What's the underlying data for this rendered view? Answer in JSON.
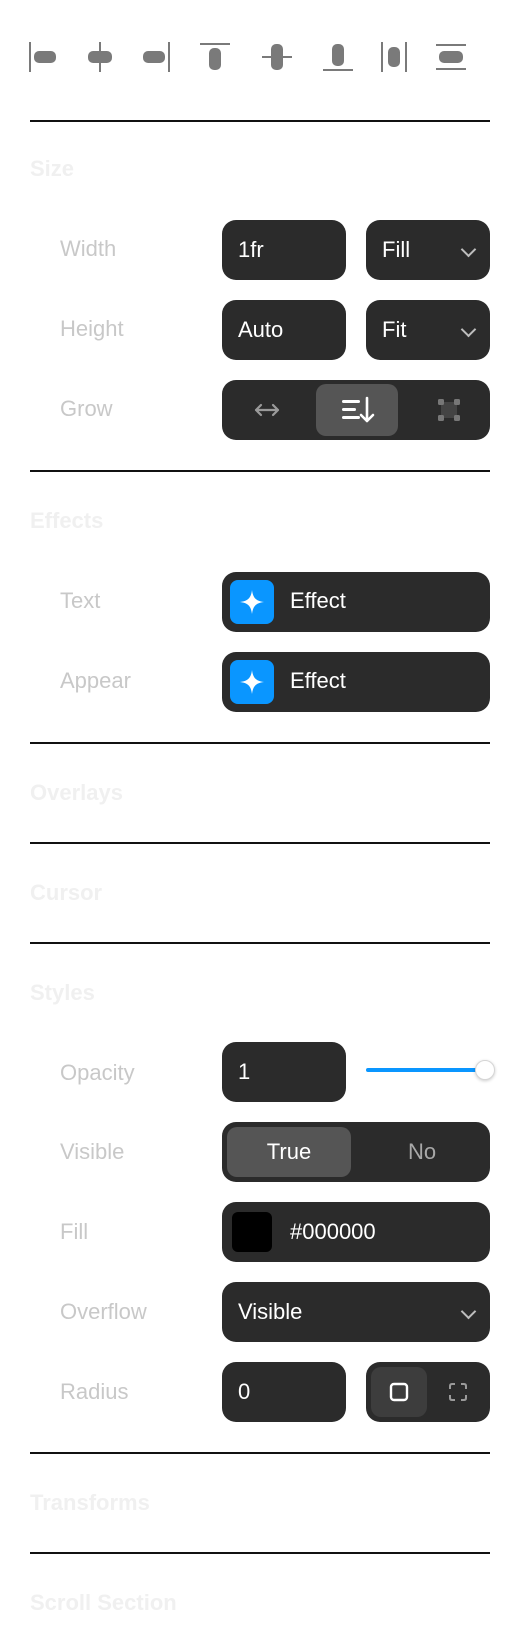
{
  "alignment": {
    "icons": [
      "align-left-icon",
      "align-center-horizontal-icon",
      "align-right-icon",
      "align-top-icon",
      "align-center-vertical-icon",
      "align-bottom-icon",
      "distribute-horizontal-icon",
      "distribute-vertical-icon"
    ]
  },
  "size": {
    "title": "Size",
    "width_label": "Width",
    "width_value": "1fr",
    "width_mode": "Fill",
    "height_label": "Height",
    "height_value": "Auto",
    "height_mode": "Fit",
    "grow_label": "Grow",
    "grow_icons": [
      "horizontal-arrows-icon",
      "text-sort-down-icon",
      "resize-corners-icon"
    ],
    "grow_selected_index": 1
  },
  "effects": {
    "title": "Effects",
    "text_label": "Text",
    "text_effect": "Effect",
    "appear_label": "Appear",
    "appear_effect": "Effect",
    "accent": "#0a96ff"
  },
  "overlays": {
    "title": "Overlays"
  },
  "cursor": {
    "title": "Cursor"
  },
  "styles": {
    "title": "Styles",
    "opacity_label": "Opacity",
    "opacity_value": "1",
    "opacity_slider_fraction": 1.0,
    "slider_color": "#0a96ff",
    "visible_label": "Visible",
    "visible_true": "True",
    "visible_false": "No",
    "fill_label": "Fill",
    "fill_value": "#000000",
    "overflow_label": "Overflow",
    "overflow_value": "Visible",
    "radius_label": "Radius",
    "radius_value": "0",
    "radius_icons": [
      "radius-all-icon",
      "radius-individual-icon"
    ]
  },
  "transforms": {
    "title": "Transforms"
  },
  "scroll_section": {
    "title": "Scroll Section"
  }
}
